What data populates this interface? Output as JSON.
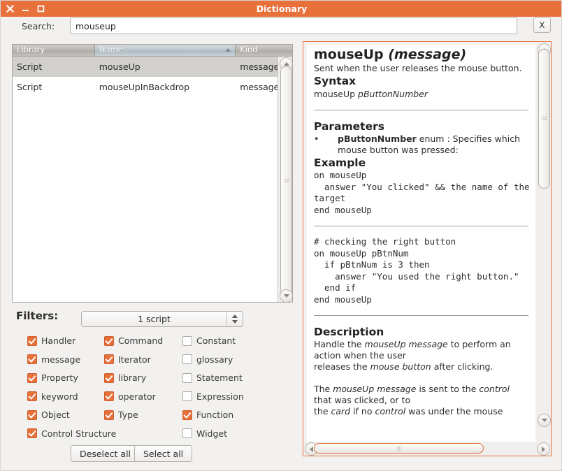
{
  "window": {
    "title": "Dictionary",
    "controls": [
      {
        "name": "close",
        "glyph": "✖"
      },
      {
        "name": "minimize",
        "glyph": "–"
      },
      {
        "name": "maximize",
        "glyph": "□"
      }
    ]
  },
  "search": {
    "label": "Search:",
    "value": "mouseup",
    "placeholder": "",
    "clear_button": "X"
  },
  "list": {
    "columns": [
      {
        "key": "library",
        "label": "Library",
        "sorted": false
      },
      {
        "key": "name",
        "label": "Name",
        "sorted": true,
        "direction": "ascending"
      },
      {
        "key": "kind",
        "label": "Kind",
        "sorted": false
      }
    ],
    "rows": [
      {
        "library": "Script",
        "name": "mouseUp",
        "kind": "message",
        "selected": true
      },
      {
        "library": "Script",
        "name": "mouseUpInBackdrop",
        "kind": "message",
        "selected": false
      }
    ]
  },
  "filters": {
    "title": "Filters:",
    "scope_value": "1 script",
    "items": [
      {
        "label": "Handler",
        "checked": true,
        "col": 0,
        "row": 0
      },
      {
        "label": "message",
        "checked": true,
        "col": 0,
        "row": 1
      },
      {
        "label": "Property",
        "checked": true,
        "col": 0,
        "row": 2
      },
      {
        "label": "keyword",
        "checked": true,
        "col": 0,
        "row": 3
      },
      {
        "label": "Object",
        "checked": true,
        "col": 0,
        "row": 4
      },
      {
        "label": "Control Structure",
        "checked": true,
        "col": 0,
        "row": 5
      },
      {
        "label": "Command",
        "checked": true,
        "col": 1,
        "row": 0
      },
      {
        "label": "Iterator",
        "checked": true,
        "col": 1,
        "row": 1
      },
      {
        "label": "library",
        "checked": true,
        "col": 1,
        "row": 2
      },
      {
        "label": "operator",
        "checked": true,
        "col": 1,
        "row": 3
      },
      {
        "label": "Type",
        "checked": true,
        "col": 1,
        "row": 4
      },
      {
        "label": "Constant",
        "checked": false,
        "col": 2,
        "row": 0
      },
      {
        "label": "glossary",
        "checked": false,
        "col": 2,
        "row": 1
      },
      {
        "label": "Statement",
        "checked": false,
        "col": 2,
        "row": 2
      },
      {
        "label": "Expression",
        "checked": false,
        "col": 2,
        "row": 3
      },
      {
        "label": "Function",
        "checked": true,
        "col": 2,
        "row": 4
      },
      {
        "label": "Widget",
        "checked": false,
        "col": 2,
        "row": 5
      }
    ],
    "deselect_all": "Deselect all",
    "select_all": "Select all"
  },
  "doc": {
    "title_name": "mouseUp ",
    "title_kind": "(message)",
    "summary": "Sent when the user releases the mouse button.",
    "syntax_heading": "Syntax",
    "syntax_plain": "mouseUp ",
    "syntax_param": "pButtonNumber",
    "parameters_heading": "Parameters",
    "param_bullet": "•",
    "param_name": "pButtonNumber",
    "param_text": " enum : Specifies which mouse button was pressed:",
    "example_heading": "Example",
    "example_code_1": "on mouseUp\n  answer \"You clicked\" && the name of the\ntarget\nend mouseUp",
    "example_code_2": "# checking the right button\non mouseUp pBtnNum\n  if pBtnNum is 3 then\n    answer \"You used the right button.\"\n  end if\nend mouseUp",
    "description_heading": "Description",
    "description_p1_a": "Handle the ",
    "description_p1_b": "mouseUp message",
    "description_p1_c": " to perform an action when the user",
    "description_p2_a": "releases the ",
    "description_p2_b": "mouse button",
    "description_p2_c": " after clicking.",
    "description_p3_a": "The ",
    "description_p3_b": "mouseUp message",
    "description_p3_c": " is sent to the ",
    "description_p3_d": "control",
    "description_p3_e": " that was clicked, or to",
    "description_p4_a": "the ",
    "description_p4_b": "card",
    "description_p4_c": " if no ",
    "description_p4_d": "control",
    "description_p4_e": " was under the mouse"
  },
  "colors": {
    "titlebar": "#e8703a",
    "accent": "#e8703a",
    "window_bg": "#f2f1f0",
    "selection": "#d2d0cd"
  }
}
